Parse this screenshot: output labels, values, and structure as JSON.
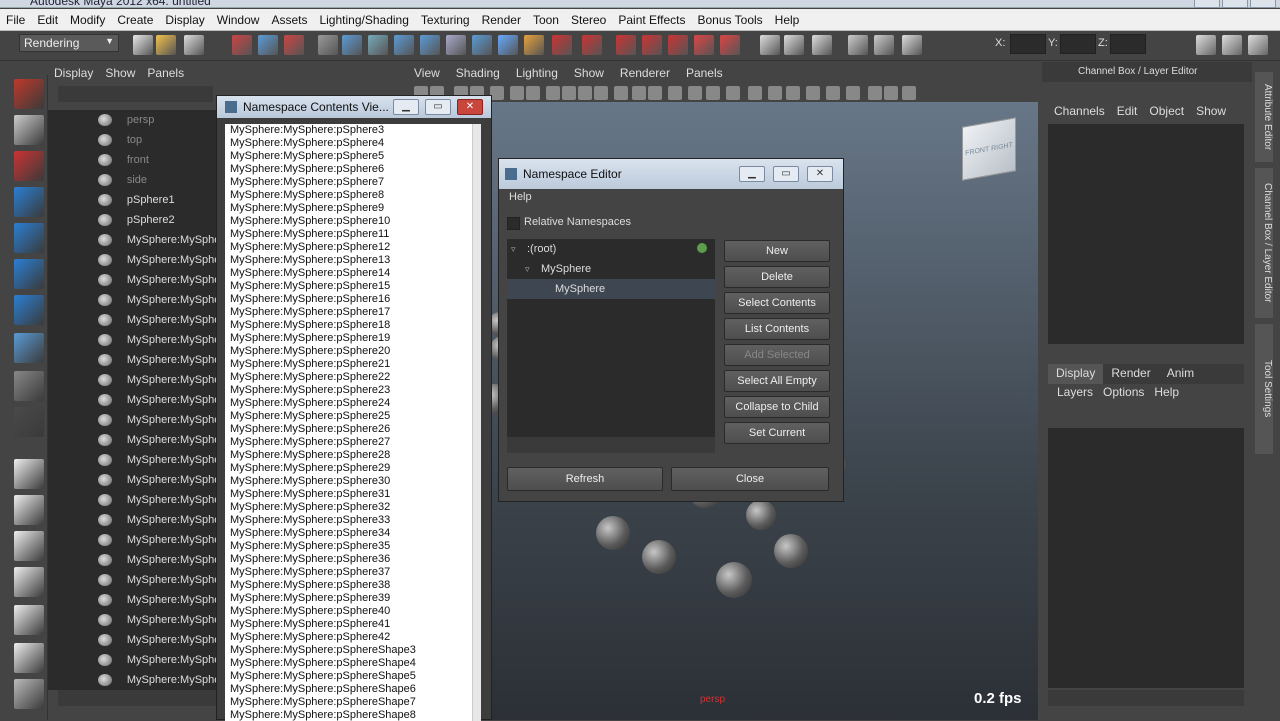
{
  "window": {
    "title": "Autodesk Maya 2012 x64: untitled"
  },
  "menubar": [
    "File",
    "Edit",
    "Modify",
    "Create",
    "Display",
    "Window",
    "Assets",
    "Lighting/Shading",
    "Texturing",
    "Render",
    "Toon",
    "Stereo",
    "Paint Effects",
    "Bonus Tools",
    "Help"
  ],
  "toolbar": {
    "mode": "Rendering",
    "x_label": "X:",
    "y_label": "Y:",
    "z_label": "Z:"
  },
  "outliner": {
    "menu": [
      "Display",
      "Show",
      "Panels"
    ],
    "items": [
      {
        "label": "persp",
        "dim": true
      },
      {
        "label": "top",
        "dim": true
      },
      {
        "label": "front",
        "dim": true
      },
      {
        "label": "side",
        "dim": true
      },
      {
        "label": "pSphere1"
      },
      {
        "label": "pSphere2"
      },
      {
        "label": "MySphere:MySphere"
      },
      {
        "label": "MySphere:MySphere"
      },
      {
        "label": "MySphere:MySphere"
      },
      {
        "label": "MySphere:MySphere"
      },
      {
        "label": "MySphere:MySphere"
      },
      {
        "label": "MySphere:MySphere"
      },
      {
        "label": "MySphere:MySphere"
      },
      {
        "label": "MySphere:MySphere"
      },
      {
        "label": "MySphere:MySphere"
      },
      {
        "label": "MySphere:MySphere"
      },
      {
        "label": "MySphere:MySphere"
      },
      {
        "label": "MySphere:MySphere"
      },
      {
        "label": "MySphere:MySphere"
      },
      {
        "label": "MySphere:MySphere"
      },
      {
        "label": "MySphere:MySphere"
      },
      {
        "label": "MySphere:MySphere"
      },
      {
        "label": "MySphere:MySphere"
      },
      {
        "label": "MySphere:MySphere"
      },
      {
        "label": "MySphere:MySphere"
      },
      {
        "label": "MySphere:MySphere"
      },
      {
        "label": "MySphere:MySphere"
      },
      {
        "label": "MySphere:MySphere"
      },
      {
        "label": "MySphere:MySphere"
      }
    ]
  },
  "ns_contents": {
    "title": "Namespace Contents Vie...",
    "items": [
      "MySphere:MySphere:pSphere3",
      "MySphere:MySphere:pSphere4",
      "MySphere:MySphere:pSphere5",
      "MySphere:MySphere:pSphere6",
      "MySphere:MySphere:pSphere7",
      "MySphere:MySphere:pSphere8",
      "MySphere:MySphere:pSphere9",
      "MySphere:MySphere:pSphere10",
      "MySphere:MySphere:pSphere11",
      "MySphere:MySphere:pSphere12",
      "MySphere:MySphere:pSphere13",
      "MySphere:MySphere:pSphere14",
      "MySphere:MySphere:pSphere15",
      "MySphere:MySphere:pSphere16",
      "MySphere:MySphere:pSphere17",
      "MySphere:MySphere:pSphere18",
      "MySphere:MySphere:pSphere19",
      "MySphere:MySphere:pSphere20",
      "MySphere:MySphere:pSphere21",
      "MySphere:MySphere:pSphere22",
      "MySphere:MySphere:pSphere23",
      "MySphere:MySphere:pSphere24",
      "MySphere:MySphere:pSphere25",
      "MySphere:MySphere:pSphere26",
      "MySphere:MySphere:pSphere27",
      "MySphere:MySphere:pSphere28",
      "MySphere:MySphere:pSphere29",
      "MySphere:MySphere:pSphere30",
      "MySphere:MySphere:pSphere31",
      "MySphere:MySphere:pSphere32",
      "MySphere:MySphere:pSphere33",
      "MySphere:MySphere:pSphere34",
      "MySphere:MySphere:pSphere35",
      "MySphere:MySphere:pSphere36",
      "MySphere:MySphere:pSphere37",
      "MySphere:MySphere:pSphere38",
      "MySphere:MySphere:pSphere39",
      "MySphere:MySphere:pSphere40",
      "MySphere:MySphere:pSphere41",
      "MySphere:MySphere:pSphere42",
      "MySphere:MySphere:pSphereShape3",
      "MySphere:MySphere:pSphereShape4",
      "MySphere:MySphere:pSphereShape5",
      "MySphere:MySphere:pSphereShape6",
      "MySphere:MySphere:pSphereShape7",
      "MySphere:MySphere:pSphereShape8"
    ]
  },
  "viewport": {
    "menu": [
      "View",
      "Shading",
      "Lighting",
      "Show",
      "Renderer",
      "Panels"
    ],
    "fps": "0.2 fps",
    "camera": "persp",
    "cube_front": "FRONT",
    "cube_right": "RIGHT"
  },
  "ns_editor": {
    "title": "Namespace Editor",
    "help": "Help",
    "relative": "Relative Namespaces",
    "tree": [
      {
        "label": ":(root)",
        "arrow": "▿"
      },
      {
        "label": "MySphere",
        "arrow": "▿"
      },
      {
        "label": "MySphere",
        "arrow": ""
      }
    ],
    "buttons": [
      "New",
      "Delete",
      "Select Contents",
      "List Contents",
      "Add Selected",
      "Select All Empty",
      "Collapse to Child",
      "Set Current"
    ],
    "refresh": "Refresh",
    "close": "Close"
  },
  "channel_box": {
    "title": "Channel Box / Layer Editor",
    "menu": [
      "Channels",
      "Edit",
      "Object",
      "Show"
    ],
    "tabs": [
      "Display",
      "Render",
      "Anim"
    ],
    "layer_menu": [
      "Layers",
      "Options",
      "Help"
    ]
  },
  "side_tabs": [
    "Attribute Editor",
    "Channel Box / Layer Editor",
    "Tool Settings"
  ],
  "colors": {
    "accent": "#5c9e4b",
    "selected_row": "#3e4652",
    "close_red": "#c9463d"
  }
}
